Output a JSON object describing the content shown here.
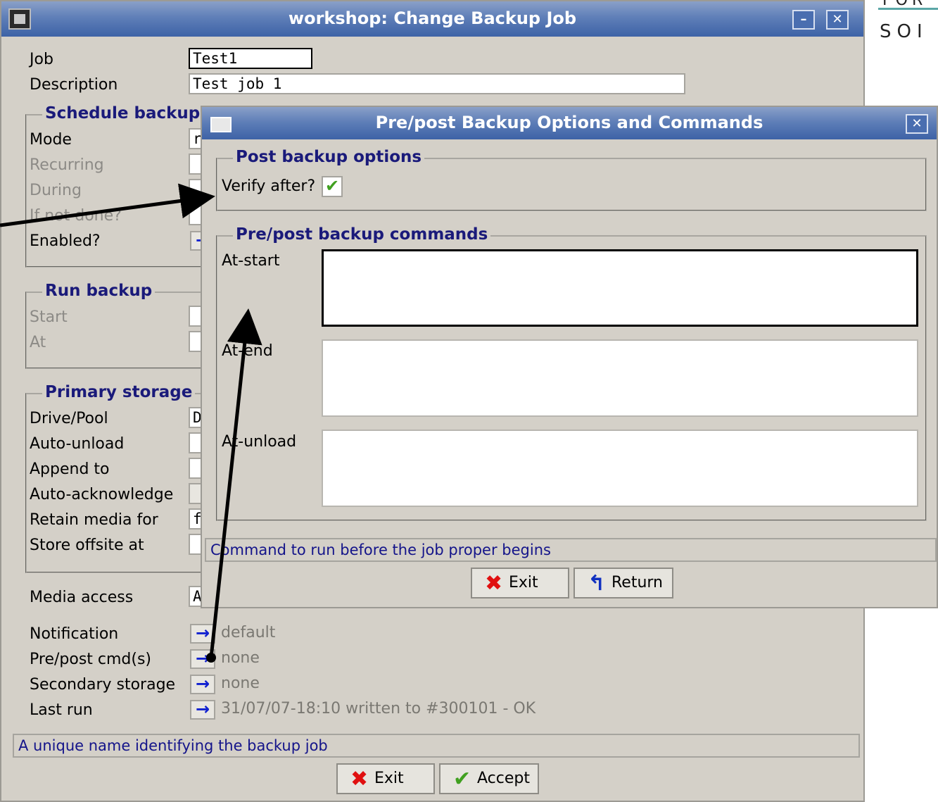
{
  "brand": {
    "top_text": "FOR",
    "bottom_text": "SOI"
  },
  "main_window": {
    "title": "workshop: Change Backup Job",
    "minimize_label": "–",
    "close_label": "✕",
    "job_label": "Job",
    "job_value": "Test1",
    "description_label": "Description",
    "description_value": "Test job 1",
    "schedule_title": "Schedule backup",
    "mode_label": "Mode",
    "mode_value": "r",
    "recurring_label": "Recurring",
    "during_label": "During",
    "if_not_done_label": "If not done?",
    "enabled_label": "Enabled?",
    "run_title": "Run backup",
    "start_label": "Start",
    "at_label": "At",
    "primary_title": "Primary storage",
    "drive_pool_label": "Drive/Pool",
    "drive_pool_value": "D",
    "auto_unload_label": "Auto-unload",
    "append_to_label": "Append to",
    "auto_ack_label": "Auto-acknowledge",
    "retain_label": "Retain media for",
    "retain_value": "f",
    "store_offsite_label": "Store offsite at",
    "media_access_label": "Media access",
    "media_access_value": "A",
    "notification_label": "Notification",
    "notification_value": "default",
    "prepost_label": "Pre/post cmd(s)",
    "prepost_value": "none",
    "secondary_label": "Secondary storage",
    "secondary_value": "none",
    "last_run_label": "Last run",
    "last_run_value": "31/07/07-18:10 written to #300101 - OK",
    "status_text": "A unique name identifying the backup job",
    "exit_label": "Exit",
    "accept_label": "Accept"
  },
  "dialog": {
    "title": "Pre/post Backup Options and Commands",
    "close_label": "✕",
    "post_options_title": "Post backup options",
    "verify_label": "Verify after?",
    "verify_checked": true,
    "commands_title": "Pre/post backup commands",
    "at_start_label": "At-start",
    "at_end_label": "At-end",
    "at_unload_label": "At-unload",
    "status_text": "Command to run before the job proper begins",
    "exit_label": "Exit",
    "return_label": "Return"
  },
  "icons": {
    "arrow_right": "→",
    "check": "✔",
    "cross": "✖",
    "return": "↰"
  },
  "colors": {
    "titlebar": "#3d62a6",
    "group_title": "#1a1a7a",
    "window_bg": "#d4d0c8",
    "exit_icon": "#e01010",
    "check_icon": "#40a020"
  }
}
